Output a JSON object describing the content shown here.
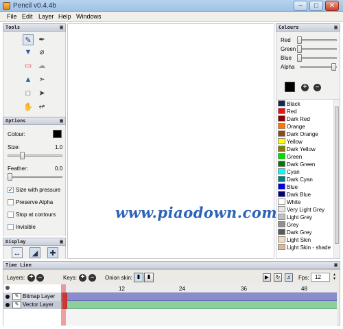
{
  "window": {
    "title": "Pencil v0.4.4b"
  },
  "menu": [
    "File",
    "Edit",
    "Layer",
    "Help",
    "Windows"
  ],
  "tools_panel": {
    "title": "Tools"
  },
  "options_panel": {
    "title": "Options",
    "colour_label": "Colour:",
    "colour_value": "#000000",
    "size_label": "Size:",
    "size_value": "1.0",
    "feather_label": "Feather:",
    "feather_value": "0.0",
    "checks": [
      {
        "label": "Size with pressure",
        "checked": true
      },
      {
        "label": "Preserve Alpha",
        "checked": false
      },
      {
        "label": "Stop at contours",
        "checked": false
      },
      {
        "label": "Invisible",
        "checked": false
      }
    ]
  },
  "display_panel": {
    "title": "Display"
  },
  "colours_panel": {
    "title": "Colours",
    "sliders": [
      {
        "label": "Red",
        "value": 0
      },
      {
        "label": "Green",
        "value": 0
      },
      {
        "label": "Blue",
        "value": 0
      },
      {
        "label": "Alpha",
        "value": 1
      }
    ],
    "current_colour": "#000000",
    "palette": [
      {
        "name": "Black",
        "color": "#10294e"
      },
      {
        "name": "Red",
        "color": "#ee1111"
      },
      {
        "name": "Dark Red",
        "color": "#880000"
      },
      {
        "name": "Orange",
        "color": "#ff7700"
      },
      {
        "name": "Dark Orange",
        "color": "#8a4a12"
      },
      {
        "name": "Yellow",
        "color": "#ffff00"
      },
      {
        "name": "Dark Yellow",
        "color": "#808000"
      },
      {
        "name": "Green",
        "color": "#00dd00"
      },
      {
        "name": "Dark Green",
        "color": "#007700"
      },
      {
        "name": "Cyan",
        "color": "#00ffff"
      },
      {
        "name": "Dark Cyan",
        "color": "#007f7f"
      },
      {
        "name": "Blue",
        "color": "#0000dd"
      },
      {
        "name": "Dark Blue",
        "color": "#000077"
      },
      {
        "name": "White",
        "color": "#ffffff"
      },
      {
        "name": "Very Light Grey",
        "color": "#e8e8e8"
      },
      {
        "name": "Light Grey",
        "color": "#c0c0c0"
      },
      {
        "name": "Grey",
        "color": "#909090"
      },
      {
        "name": "Dark Grey",
        "color": "#5a5a5a"
      },
      {
        "name": "Light Skin",
        "color": "#f7dcc0"
      },
      {
        "name": "Light Skin - shade",
        "color": "#d9b896"
      }
    ]
  },
  "timeline": {
    "title": "Time Line",
    "layers_label": "Layers:",
    "keys_label": "Keys:",
    "onion_label": "Onion skin:",
    "fps_label": "Fps:",
    "fps_value": "12",
    "ruler": [
      "12",
      "24",
      "36",
      "48"
    ],
    "layers": [
      {
        "name": "Bitmap Layer"
      },
      {
        "name": "Vector Layer"
      }
    ]
  },
  "watermark": "www.piaodown.com"
}
